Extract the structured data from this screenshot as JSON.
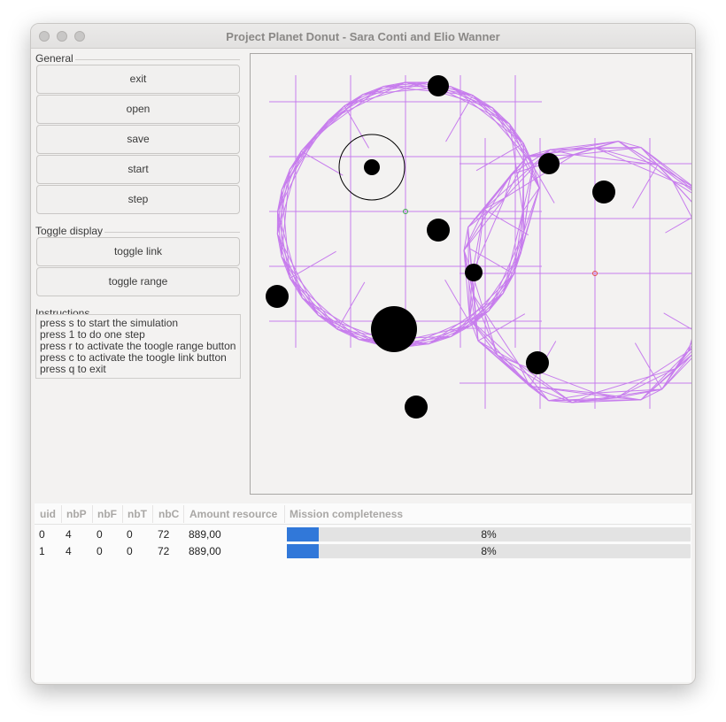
{
  "window": {
    "title": "Project Planet Donut - Sara Conti and Elio Wanner"
  },
  "general": {
    "label": "General",
    "buttons": [
      "exit",
      "open",
      "save",
      "start",
      "step"
    ]
  },
  "toggle_display": {
    "label": "Toggle display",
    "buttons": [
      "toggle link",
      "toggle range"
    ]
  },
  "instructions": {
    "label": "Instructions",
    "lines": [
      "press s to start the simulation",
      "press 1 to do one step",
      "press r to activate the toogle range button",
      "press c to activate the toogle link button",
      "press q to exit"
    ]
  },
  "colors": {
    "link_lines": "#c77ded",
    "accent_blue": "#3178d9",
    "base_marker_green": "#3aaa4a",
    "base_marker_red": "#e04a4a"
  },
  "table": {
    "columns": [
      "uid",
      "nbP",
      "nbF",
      "nbT",
      "nbC",
      "Amount resource",
      "Mission completeness"
    ],
    "rows": [
      {
        "uid": "0",
        "nbP": "4",
        "nbF": "0",
        "nbT": "0",
        "nbC": "72",
        "amount": "889,00",
        "completeness": 0.08,
        "completeness_text": "8%"
      },
      {
        "uid": "1",
        "nbP": "4",
        "nbF": "0",
        "nbT": "0",
        "nbC": "72",
        "amount": "889,00",
        "completeness": 0.08,
        "completeness_text": "8%"
      }
    ]
  }
}
